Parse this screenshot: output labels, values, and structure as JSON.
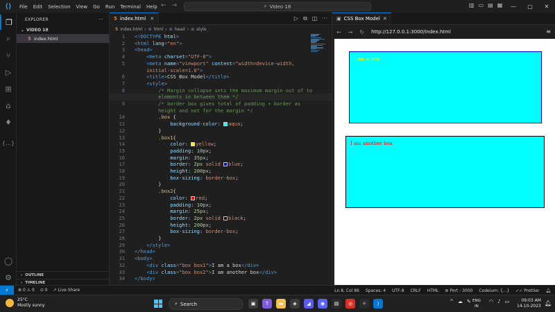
{
  "menu": [
    "File",
    "Edit",
    "Selection",
    "View",
    "Go",
    "Run",
    "Terminal",
    "Help"
  ],
  "command_center": "Video 18",
  "explorer": {
    "title": "EXPLORER",
    "folder": "VIDEO 18",
    "file": "index.html",
    "outline": "OUTLINE",
    "timeline": "TIMELINE"
  },
  "editor": {
    "tab": "index.html",
    "breadcrumb": [
      "index.html",
      "html",
      "head",
      "style"
    ]
  },
  "code": [
    {
      "n": "1",
      "parts": [
        [
          "t",
          "<!DOCTYPE "
        ],
        [
          "a",
          "html"
        ],
        [
          "t",
          ">"
        ]
      ]
    },
    {
      "n": "2",
      "parts": [
        [
          "t",
          "<html "
        ],
        [
          "a",
          "lang"
        ],
        [
          "g",
          "="
        ],
        [
          "s",
          "\"en\""
        ],
        [
          "t",
          ">"
        ]
      ]
    },
    {
      "n": "3",
      "parts": [
        [
          "t",
          "<head>"
        ]
      ]
    },
    {
      "n": "4",
      "parts": [
        [
          "x",
          "    "
        ],
        [
          "t",
          "<meta "
        ],
        [
          "a",
          "charset"
        ],
        [
          "g",
          "="
        ],
        [
          "s",
          "\"UTF-8\""
        ],
        [
          "t",
          ">"
        ]
      ]
    },
    {
      "n": "5",
      "parts": [
        [
          "x",
          "    "
        ],
        [
          "t",
          "<meta "
        ],
        [
          "a",
          "name"
        ],
        [
          "g",
          "="
        ],
        [
          "s",
          "\"viewport\""
        ],
        [
          "x",
          " "
        ],
        [
          "a",
          "content"
        ],
        [
          "g",
          "="
        ],
        [
          "s",
          "\"width=device-width,"
        ]
      ]
    },
    {
      "n": "",
      "parts": [
        [
          "s",
          "    initial-scale=1.0\""
        ],
        [
          "t",
          ">"
        ]
      ]
    },
    {
      "n": "6",
      "parts": [
        [
          "x",
          "    "
        ],
        [
          "t",
          "<title>"
        ],
        [
          "x",
          "CSS Box Model"
        ],
        [
          "t",
          "</title>"
        ]
      ]
    },
    {
      "n": "7",
      "parts": [
        [
          "x",
          "    "
        ],
        [
          "t",
          "<style>"
        ]
      ]
    },
    {
      "n": "8",
      "parts": [
        [
          "x",
          "        "
        ],
        [
          "c",
          "/* Margin collapse sets the maximum margin out of to"
        ]
      ]
    },
    {
      "n": "",
      "cursor": true,
      "parts": [
        [
          "c",
          "        elements in between them */"
        ]
      ]
    },
    {
      "n": "9",
      "parts": [
        [
          "x",
          "        "
        ],
        [
          "c",
          "/* border box gives total of padding + border as"
        ]
      ]
    },
    {
      "n": "",
      "parts": [
        [
          "c",
          "        height and not for the margin */"
        ]
      ]
    },
    {
      "n": "10",
      "parts": [
        [
          "x",
          "        "
        ],
        [
          "sel",
          ".box"
        ],
        [
          "x",
          " {"
        ]
      ]
    },
    {
      "n": "11",
      "parts": [
        [
          "x",
          "            "
        ],
        [
          "p",
          "background-color"
        ],
        [
          "x",
          ": "
        ],
        [
          "sw",
          "#00ffff"
        ],
        [
          "v",
          "aqua"
        ],
        [
          "x",
          ";"
        ]
      ]
    },
    {
      "n": "12",
      "parts": [
        [
          "x",
          "        }"
        ]
      ]
    },
    {
      "n": "13",
      "parts": [
        [
          "x",
          "        "
        ],
        [
          "sel",
          ".box1"
        ],
        [
          "x",
          "{"
        ]
      ]
    },
    {
      "n": "14",
      "parts": [
        [
          "x",
          "            "
        ],
        [
          "p",
          "color"
        ],
        [
          "x",
          ": "
        ],
        [
          "sw",
          "#ffff00"
        ],
        [
          "v",
          "yellow"
        ],
        [
          "x",
          ";"
        ]
      ]
    },
    {
      "n": "15",
      "parts": [
        [
          "x",
          "            "
        ],
        [
          "p",
          "padding"
        ],
        [
          "x",
          ": "
        ],
        [
          "n",
          "10px"
        ],
        [
          "x",
          ";"
        ]
      ]
    },
    {
      "n": "16",
      "parts": [
        [
          "x",
          "            "
        ],
        [
          "p",
          "margin"
        ],
        [
          "x",
          ": "
        ],
        [
          "n",
          "35px"
        ],
        [
          "x",
          ";"
        ]
      ]
    },
    {
      "n": "17",
      "parts": [
        [
          "x",
          "            "
        ],
        [
          "p",
          "border"
        ],
        [
          "x",
          ": "
        ],
        [
          "n",
          "2px"
        ],
        [
          "x",
          " "
        ],
        [
          "v",
          "solid"
        ],
        [
          "x",
          " "
        ],
        [
          "sw",
          "#0000ff"
        ],
        [
          "v",
          "blue"
        ],
        [
          "x",
          ";"
        ]
      ]
    },
    {
      "n": "18",
      "parts": [
        [
          "x",
          "            "
        ],
        [
          "p",
          "height"
        ],
        [
          "x",
          ": "
        ],
        [
          "n",
          "200px"
        ],
        [
          "x",
          ";"
        ]
      ]
    },
    {
      "n": "19",
      "parts": [
        [
          "x",
          "            "
        ],
        [
          "p",
          "box-sizing"
        ],
        [
          "x",
          ": "
        ],
        [
          "v",
          "border-box"
        ],
        [
          "x",
          ";"
        ]
      ]
    },
    {
      "n": "20",
      "parts": [
        [
          "x",
          "        }"
        ]
      ]
    },
    {
      "n": "21",
      "parts": [
        [
          "x",
          "        "
        ],
        [
          "sel",
          ".box2"
        ],
        [
          "x",
          "{"
        ]
      ]
    },
    {
      "n": "22",
      "parts": [
        [
          "x",
          "            "
        ],
        [
          "p",
          "color"
        ],
        [
          "x",
          ": "
        ],
        [
          "sw",
          "#ff0000"
        ],
        [
          "v",
          "red"
        ],
        [
          "x",
          ";"
        ]
      ]
    },
    {
      "n": "23",
      "parts": [
        [
          "x",
          "            "
        ],
        [
          "p",
          "padding"
        ],
        [
          "x",
          ": "
        ],
        [
          "n",
          "10px"
        ],
        [
          "x",
          ";"
        ]
      ]
    },
    {
      "n": "24",
      "parts": [
        [
          "x",
          "            "
        ],
        [
          "p",
          "margin"
        ],
        [
          "x",
          ": "
        ],
        [
          "n",
          "25px"
        ],
        [
          "x",
          ";"
        ]
      ]
    },
    {
      "n": "25",
      "parts": [
        [
          "x",
          "            "
        ],
        [
          "p",
          "border"
        ],
        [
          "x",
          ": "
        ],
        [
          "n",
          "2px"
        ],
        [
          "x",
          " "
        ],
        [
          "v",
          "solid"
        ],
        [
          "x",
          " "
        ],
        [
          "sw",
          "#000000"
        ],
        [
          "v",
          "black"
        ],
        [
          "x",
          ";"
        ]
      ]
    },
    {
      "n": "26",
      "parts": [
        [
          "x",
          "            "
        ],
        [
          "p",
          "height"
        ],
        [
          "x",
          ": "
        ],
        [
          "n",
          "200px"
        ],
        [
          "x",
          ";"
        ]
      ]
    },
    {
      "n": "27",
      "parts": [
        [
          "x",
          "            "
        ],
        [
          "p",
          "box-sizing"
        ],
        [
          "x",
          ": "
        ],
        [
          "v",
          "border-box"
        ],
        [
          "x",
          ";"
        ]
      ]
    },
    {
      "n": "28",
      "parts": [
        [
          "x",
          "        }"
        ]
      ]
    },
    {
      "n": "29",
      "parts": [
        [
          "x",
          "    "
        ],
        [
          "t",
          "</style>"
        ]
      ]
    },
    {
      "n": "30",
      "parts": [
        [
          "t",
          "</head>"
        ]
      ]
    },
    {
      "n": "31",
      "parts": [
        [
          "t",
          "<body>"
        ]
      ]
    },
    {
      "n": "32",
      "parts": [
        [
          "x",
          "    "
        ],
        [
          "t",
          "<div "
        ],
        [
          "a",
          "class"
        ],
        [
          "g",
          "="
        ],
        [
          "s",
          "\"box box1\""
        ],
        [
          "t",
          ">"
        ],
        [
          "x",
          "I am a box"
        ],
        [
          "t",
          "</div>"
        ]
      ]
    },
    {
      "n": "33",
      "parts": [
        [
          "x",
          "    "
        ],
        [
          "t",
          "<div "
        ],
        [
          "a",
          "class"
        ],
        [
          "g",
          "="
        ],
        [
          "s",
          "\"box box2\""
        ],
        [
          "t",
          ">"
        ],
        [
          "x",
          "I am another box"
        ],
        [
          "t",
          "</div>"
        ]
      ]
    },
    {
      "n": "34",
      "parts": [
        [
          "t",
          "</body>"
        ]
      ]
    }
  ],
  "browser": {
    "tab": "CSS Box Model",
    "url": "http://127.0.0.1:3000/index.html",
    "box1_text": "I am a box",
    "box2_text": "I am another box",
    "box1_color": "#ffff00",
    "box2_color": "#ff0000",
    "box_bg": "#00ffff"
  },
  "status": {
    "errors": "0",
    "warnings": "0",
    "ports": "0",
    "live_share": "Live Share",
    "position": "Ln 8, Col 86",
    "spaces": "Spaces: 4",
    "encoding": "UTF-8",
    "eol": "CRLF",
    "language": "HTML",
    "port": "Port : 3000",
    "codeium": "Codeium: {...}",
    "prettier": "Prettier"
  },
  "taskbar": {
    "temp": "25°C",
    "weather": "Mostly sunny",
    "search": "Search",
    "lang1": "ENG",
    "lang2": "IN",
    "time": "09:03 AM",
    "date": "14-10-2023"
  }
}
